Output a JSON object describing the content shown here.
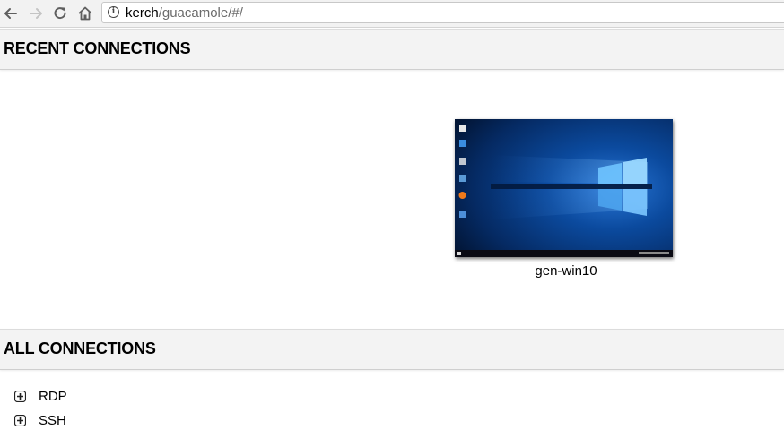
{
  "browser": {
    "url_host": "kerch",
    "url_path": "/guacamole/#/",
    "icons": [
      "back-arrow-icon",
      "forward-arrow-icon",
      "reload-icon",
      "home-icon",
      "info-icon"
    ]
  },
  "recent": {
    "title": "RECENT CONNECTIONS",
    "connections": [
      {
        "name": "gen-win10"
      }
    ]
  },
  "all": {
    "title": "ALL CONNECTIONS",
    "groups": [
      {
        "label": "RDP"
      },
      {
        "label": "SSH"
      }
    ]
  },
  "colors": {
    "header_bg": "#f3f3f3",
    "desktop_blue": "#0a3f86",
    "taskbar": "#0b0b14"
  }
}
